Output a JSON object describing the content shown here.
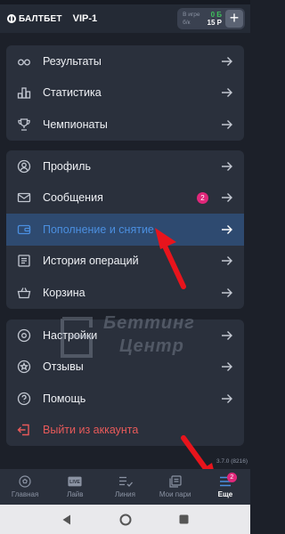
{
  "header": {
    "brand": "БАЛТБЕТ",
    "vip_label": "VIP-1",
    "balance": {
      "in_game_label": "В игре",
      "bonus_label": "б/к",
      "in_game_value": "0 Б",
      "main_value": "15 Р"
    },
    "add_label": "+"
  },
  "menu_groups": [
    {
      "items": [
        {
          "label": "Результаты",
          "icon": "glasses-icon"
        },
        {
          "label": "Статистика",
          "icon": "bar-chart-icon"
        },
        {
          "label": "Чемпионаты",
          "icon": "trophy-icon"
        }
      ]
    },
    {
      "items": [
        {
          "label": "Профиль",
          "icon": "user-icon"
        },
        {
          "label": "Сообщения",
          "icon": "envelope-icon",
          "badge": "2"
        },
        {
          "label": "Пополнение и снятие",
          "icon": "wallet-icon",
          "active": true
        },
        {
          "label": "История операций",
          "icon": "history-icon"
        },
        {
          "label": "Корзина",
          "icon": "basket-icon"
        }
      ]
    },
    {
      "items": [
        {
          "label": "Настройки",
          "icon": "gear-icon"
        },
        {
          "label": "Отзывы",
          "icon": "star-icon"
        },
        {
          "label": "Помощь",
          "icon": "help-icon"
        },
        {
          "label": "Выйти из аккаунта",
          "icon": "logout-icon",
          "danger": true
        }
      ]
    }
  ],
  "watermark": {
    "line1": "Беттинг",
    "line2": "Центр"
  },
  "version": "3.7.0 (8216)",
  "bottom_nav": [
    {
      "label": "Главная",
      "icon": "soccer-ball-icon"
    },
    {
      "label": "Лайв",
      "icon": "live-icon",
      "icon_text": "LIVE"
    },
    {
      "label": "Линия",
      "icon": "checklist-icon"
    },
    {
      "label": "Мои пари",
      "icon": "tickets-icon"
    },
    {
      "label": "Еще",
      "icon": "menu-icon",
      "active": true,
      "badge": "2"
    }
  ],
  "colors": {
    "background": "#1c2029",
    "card": "#2a303c",
    "active_row": "#2e4a70",
    "active_text": "#4b8fe0",
    "badge": "#e0277a",
    "danger": "#e85a5a",
    "annotation_arrow": "#e8141c"
  }
}
